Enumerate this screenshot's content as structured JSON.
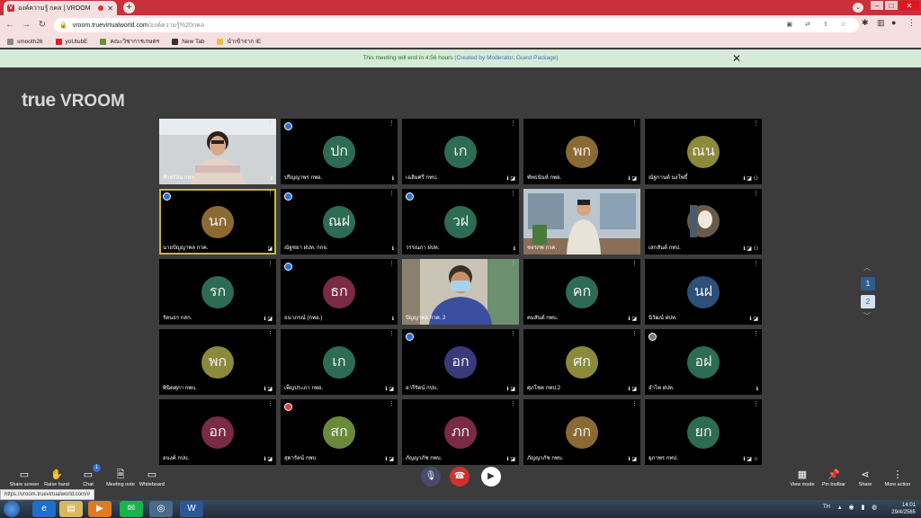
{
  "browser": {
    "tab_title": "องค์ความรู้ กคล | VROOM",
    "favicon_letter": "V",
    "new_tab": "+",
    "url_host": "vroom.truevirtualworld.com",
    "url_path": "/องค์ความรู้%20กคล",
    "bookmarks": [
      {
        "label": "smooth26",
        "color": "#888888"
      },
      {
        "label": "yoUtubE",
        "color": "#e02020"
      },
      {
        "label": "คณะวิชาการเกษตร",
        "color": "#6a8f3a"
      },
      {
        "label": "New Tab",
        "color": "#333333"
      },
      {
        "label": "นำเข้าจาก IE",
        "color": "#e8c040"
      }
    ]
  },
  "banner": {
    "text": "This meeting will end in 4:56 hours ",
    "link": "(Created by Moderator, Guest Package)"
  },
  "logo": {
    "brand": "true",
    "product": "VROOM"
  },
  "tiles": [
    {
      "name": "ฟ้าสร้อน กสก.",
      "initials": "",
      "color": "#000000",
      "video": "woman",
      "badge": "",
      "status": "ℹ",
      "active": false
    },
    {
      "name": "ปริญญาพร กพอ.",
      "initials": "ปก",
      "color": "#2d6b55",
      "video": "",
      "badge": "blue",
      "status": "ℹ",
      "active": false
    },
    {
      "name": "เฉลิมศรี กทป.",
      "initials": "เก",
      "color": "#2d6b55",
      "video": "",
      "badge": "",
      "status": "ℹ ◪",
      "active": false
    },
    {
      "name": "พัทธนันท์ กพอ.",
      "initials": "พก",
      "color": "#8a6a32",
      "video": "",
      "badge": "",
      "status": "ℹ ◪",
      "active": false
    },
    {
      "name": "ณัฐกานต์ นงโพธิ์",
      "initials": "ณน",
      "color": "#8a8a3a",
      "video": "",
      "badge": "",
      "status": "ℹ ◪ ⚇",
      "active": false
    },
    {
      "name": "นายปัญญาพล กวค.",
      "initials": "นก",
      "color": "#8a6a32",
      "video": "",
      "badge": "blue",
      "status": "◪",
      "active": true
    },
    {
      "name": "ณัฐชยา ฝปท. กกจ.",
      "initials": "ณฝ",
      "color": "#2d6b55",
      "video": "",
      "badge": "blue",
      "status": "ℹ",
      "active": false
    },
    {
      "name": "วรรณภา ฝปท.",
      "initials": "วฝ",
      "color": "#2d6b55",
      "video": "",
      "badge": "blue",
      "status": "ℹ",
      "active": false
    },
    {
      "name": "ชจรภพ กวค.",
      "initials": "",
      "color": "#000000",
      "video": "man-room",
      "badge": "",
      "status": "",
      "active": false
    },
    {
      "name": "เสกสันต์ กทป.",
      "initials": "",
      "color": "#000000",
      "video": "small",
      "badge": "",
      "status": "ℹ ◪ ⚇",
      "active": false
    },
    {
      "name": "รัตนธร กสก.",
      "initials": "รก",
      "color": "#2d6b55",
      "video": "",
      "badge": "",
      "status": "ℹ ◪",
      "active": false
    },
    {
      "name": "ธนาภรณ์ (กพอ.)",
      "initials": "ธก",
      "color": "#7a2a45",
      "video": "",
      "badge": "blue",
      "status": "ℹ",
      "active": false
    },
    {
      "name": "ปัญญาพล กวค. 2",
      "initials": "",
      "color": "#000000",
      "video": "man-mask",
      "badge": "",
      "status": "",
      "active": false
    },
    {
      "name": "คมสันต์ กพบ.",
      "initials": "คก",
      "color": "#2d6b55",
      "video": "",
      "badge": "",
      "status": "ℹ ◪",
      "active": false
    },
    {
      "name": "นิวัฒน์ ฝปท.",
      "initials": "นฝ",
      "color": "#2d4f7a",
      "video": "",
      "badge": "",
      "status": "ℹ ◪",
      "active": false
    },
    {
      "name": "พินิตศุภา กพบ.",
      "initials": "พก",
      "color": "#8a8a3a",
      "video": "",
      "badge": "",
      "status": "ℹ ◪",
      "active": false
    },
    {
      "name": "เพ็ญประภา กพอ.",
      "initials": "เก",
      "color": "#2d6b55",
      "video": "",
      "badge": "",
      "status": "ℹ ◪",
      "active": false
    },
    {
      "name": "อารีรัตน์ กปบ.",
      "initials": "อก",
      "color": "#3a3a7a",
      "video": "",
      "badge": "blue",
      "status": "ℹ ◪",
      "active": false
    },
    {
      "name": "ศุภโชค กทป.2",
      "initials": "ศก",
      "color": "#8a8a3a",
      "video": "",
      "badge": "",
      "status": "ℹ ◪",
      "active": false
    },
    {
      "name": "อำไพ ฝปท.",
      "initials": "อฝ",
      "color": "#2d6b55",
      "video": "",
      "badge": "grey",
      "status": "ℹ",
      "active": false
    },
    {
      "name": "อนงค์ กปบ.",
      "initials": "อก",
      "color": "#7a2a45",
      "video": "",
      "badge": "",
      "status": "ℹ ◪",
      "active": false
    },
    {
      "name": "สุดารัตน์ กพบ",
      "initials": "สก",
      "color": "#6a8a3a",
      "video": "",
      "badge": "red",
      "status": "ℹ ◪",
      "active": false
    },
    {
      "name": "ภัญญาภัช กพบ.",
      "initials": "ภก",
      "color": "#7a2a45",
      "video": "",
      "badge": "",
      "status": "ℹ ◪",
      "active": false
    },
    {
      "name": "ภัญญาภัช กพบ.",
      "initials": "ภก",
      "color": "#8a6a32",
      "video": "",
      "badge": "",
      "status": "ℹ ◪",
      "active": false
    },
    {
      "name": "ยุภาพร กทป.",
      "initials": "ยก",
      "color": "#2d6b55",
      "video": "",
      "badge": "",
      "status": "ℹ ◪ ☆",
      "active": false
    }
  ],
  "pager": {
    "up": "︿",
    "page1": "1",
    "page2": "2",
    "down": "﹀"
  },
  "controls": {
    "share_screen": "Share screen",
    "raise_hand": "Raise hand",
    "chat": "Chat",
    "chat_count": "1",
    "meeting_note": "Meeting note",
    "whiteboard": "Whiteboard",
    "view_mode": "View mode",
    "pin_toolbar": "Pin toolbar",
    "share": "Share",
    "more_action": "More action"
  },
  "status_url": "https://vroom.truevirtualworld.com/#",
  "taskbar": {
    "lang": "TH",
    "time": "14:01",
    "date": "29/4/2565"
  }
}
